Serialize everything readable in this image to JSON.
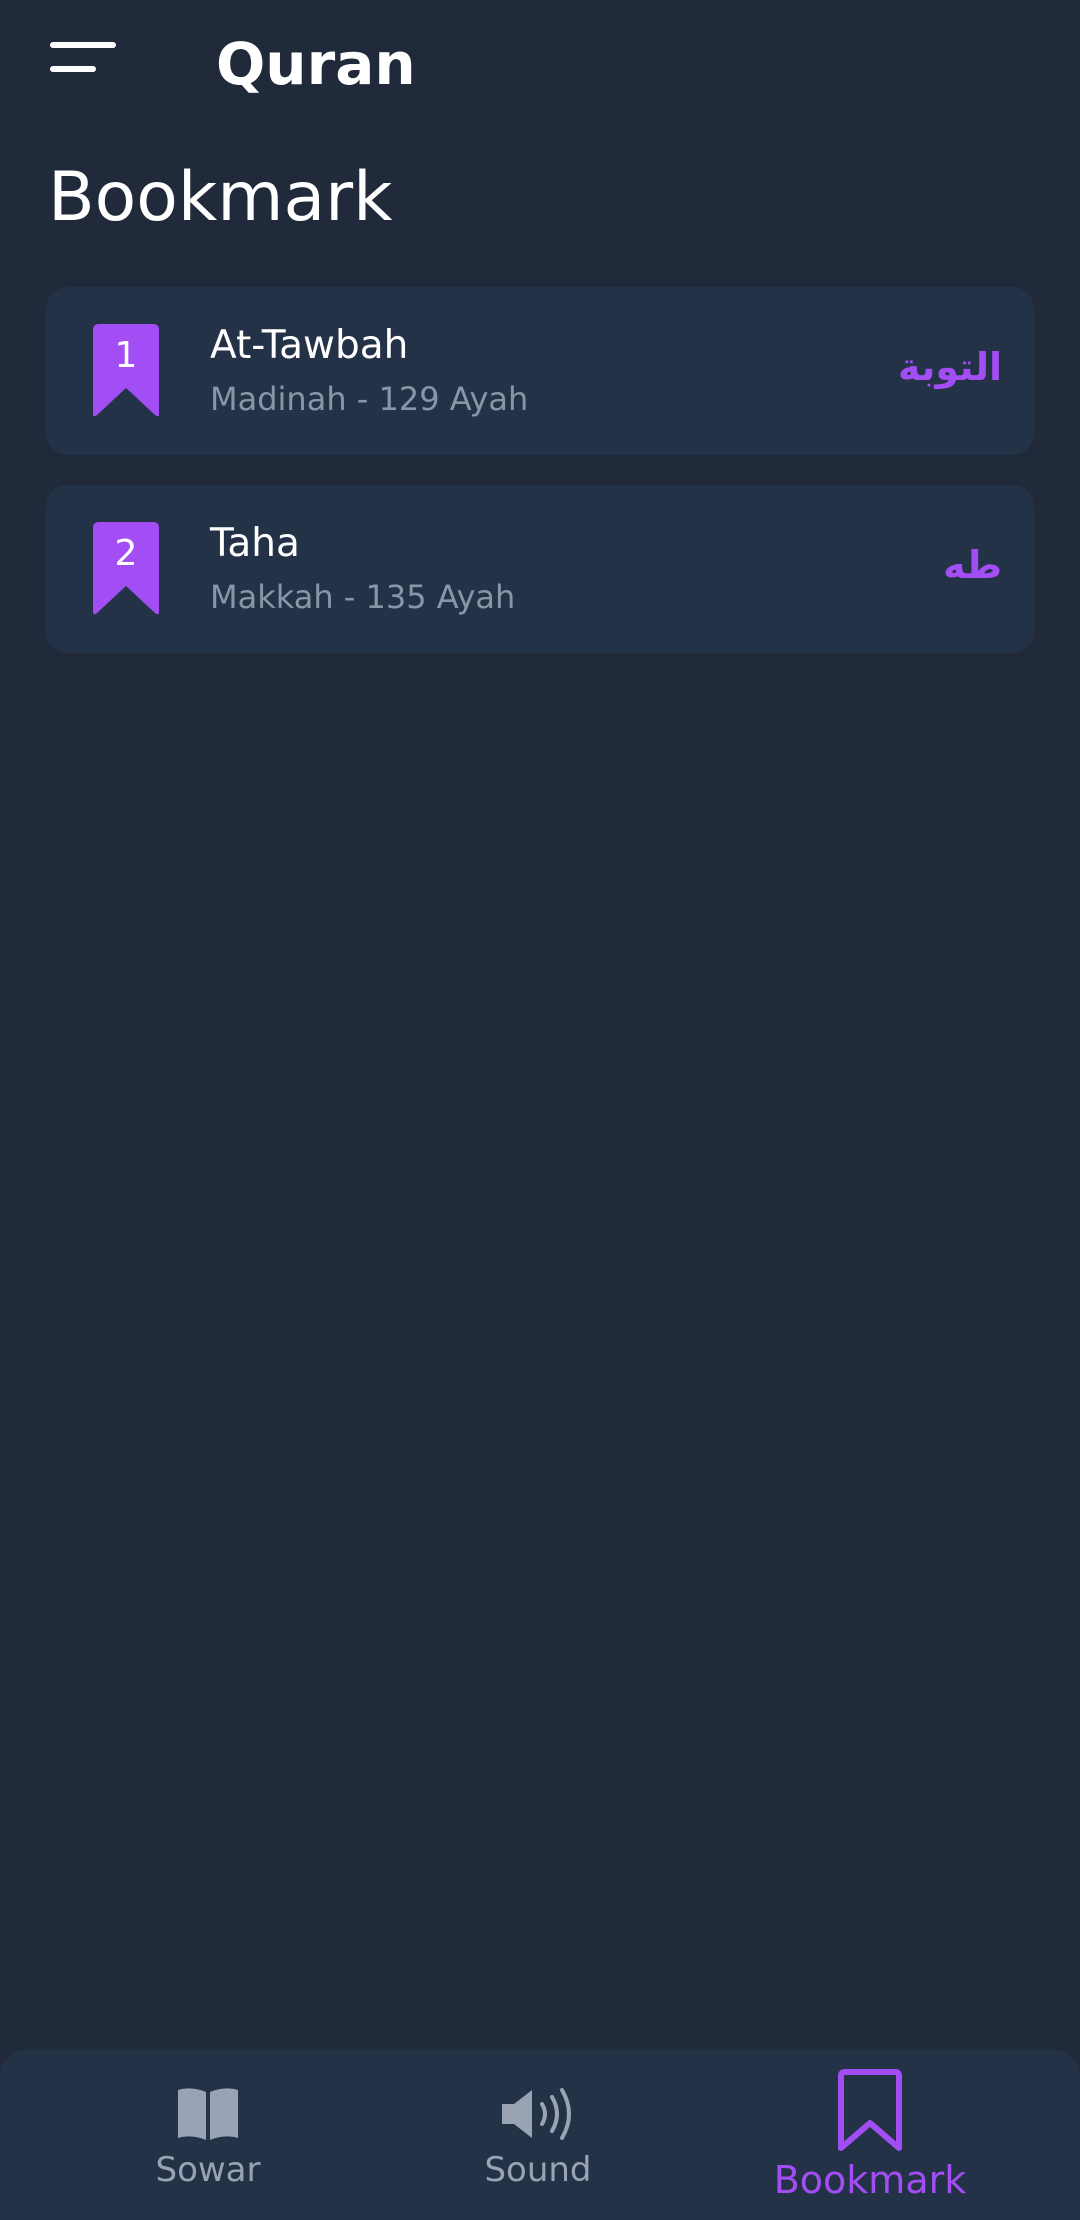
{
  "header": {
    "app_title": "Quran",
    "menu_icon": "menu-icon"
  },
  "page": {
    "title": "Bookmark"
  },
  "bookmarks": [
    {
      "index": "1",
      "name": "At-Tawbah",
      "subtitle": "Madinah - 129 Ayah",
      "arabic": "التوبة"
    },
    {
      "index": "2",
      "name": "Taha",
      "subtitle": "Makkah - 135 Ayah",
      "arabic": "طه"
    }
  ],
  "nav": {
    "items": [
      {
        "label": "Sowar",
        "icon": "book-icon",
        "active": false
      },
      {
        "label": "Sound",
        "icon": "speaker-icon",
        "active": false
      },
      {
        "label": "Bookmark",
        "icon": "bookmark-icon",
        "active": true
      }
    ]
  },
  "colors": {
    "background": "#202a3a",
    "card": "#243247",
    "accent": "#a24ef4",
    "muted": "#8a95a8"
  }
}
